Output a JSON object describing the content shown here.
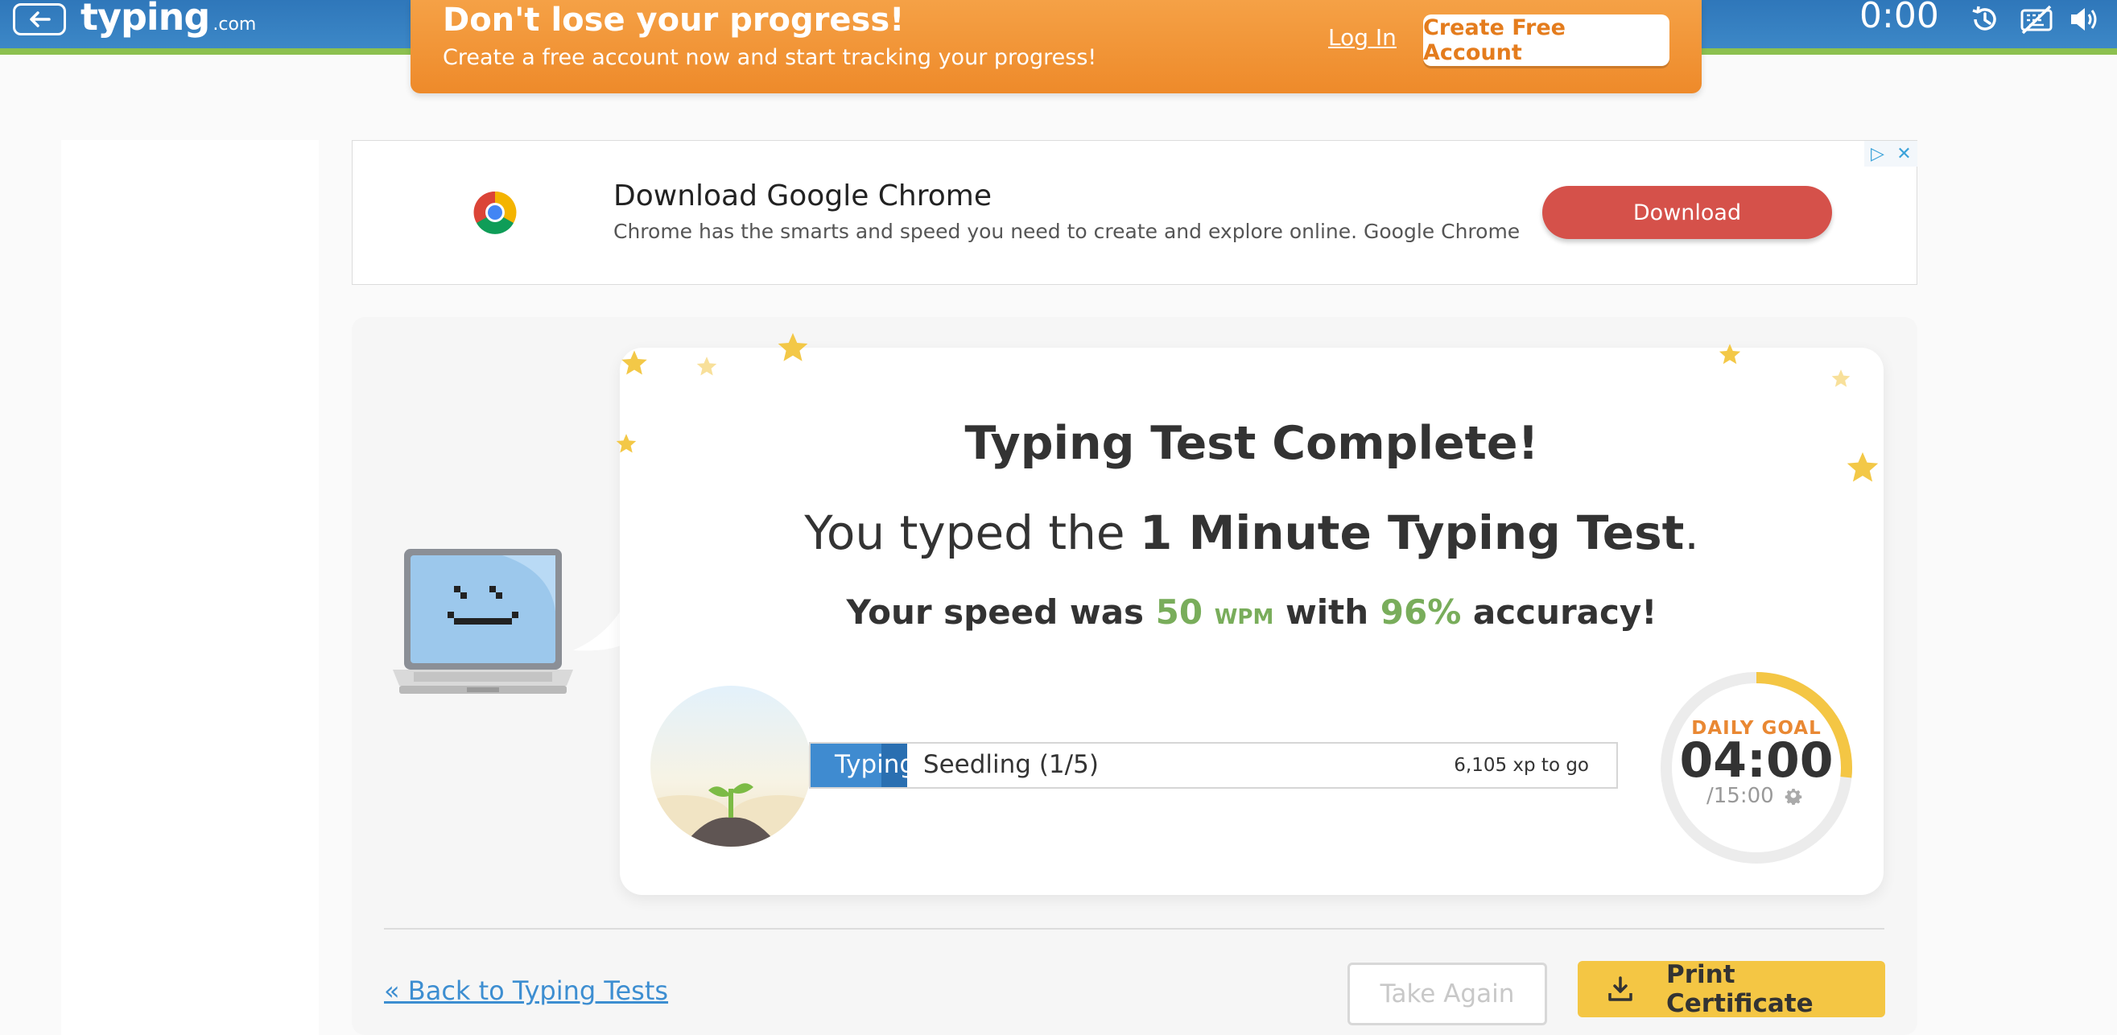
{
  "topbar": {
    "logo_main": "typing",
    "logo_suffix": ".com",
    "timer": "0:00",
    "icons": [
      "back-arrow-icon",
      "history-icon",
      "keyboard-hidden-icon",
      "sound-icon"
    ]
  },
  "promo": {
    "title": "Don't lose your progress!",
    "subtitle": "Create a free account now and start tracking your progress!",
    "login": "Log In",
    "create": "Create Free Account"
  },
  "ad": {
    "title": "Download Google Chrome",
    "subtitle": "Chrome has the smarts and speed you need to create and explore online. Google Chrome",
    "button": "Download",
    "choices_icon": "▷",
    "close_icon": "✕"
  },
  "result": {
    "title": "Typing Test Complete!",
    "line2_prefix": "You typed the ",
    "line2_test": "1 Minute Typing Test",
    "line2_suffix": ".",
    "line3_prefix": "Your speed was ",
    "wpm_value": "50",
    "wpm_unit": "WPM",
    "line3_mid": " with ",
    "accuracy": "96%",
    "line3_suffix": " accuracy!"
  },
  "level": {
    "label_on_fill": "Typing",
    "label_rest": " Seedling (1/5)",
    "xp_to_go": "6,105 xp to go",
    "progress_fraction": 0.12
  },
  "goal": {
    "label": "DAILY GOAL",
    "time": "04:00",
    "total": "/15:00",
    "progress_fraction": 0.2667
  },
  "actions": {
    "back": "« Back to Typing Tests",
    "take_again": "Take Again",
    "print": "Print Certificate"
  },
  "colors": {
    "topbar": "#3e8ac9",
    "promo": "#f0902f",
    "accent_green": "#79ad5b",
    "goal_ring": "#f4c644",
    "print_button": "#f4c644",
    "ad_button": "#d5514a"
  }
}
